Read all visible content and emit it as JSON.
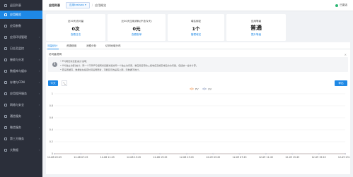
{
  "sidebar": {
    "brand": "返回列表",
    "items": [
      {
        "label": "应用概览",
        "active": true
      },
      {
        "label": "应用参数"
      },
      {
        "label": "应用环境管理",
        "arrow": true
      },
      {
        "label": "日志及监控",
        "arrow": true
      },
      {
        "label": "接收与分发",
        "arrow": true
      },
      {
        "label": "数据库与缓存",
        "arrow": true
      },
      {
        "label": "存储与CDN",
        "arrow": true
      },
      {
        "label": "应用程序服务",
        "arrow": true
      },
      {
        "label": "网络与安全",
        "arrow": true
      },
      {
        "label": "通信服务",
        "arrow": true
      },
      {
        "label": "微信服务",
        "arrow": true
      },
      {
        "label": "第三方服务",
        "arrow": true
      },
      {
        "label": "大数据",
        "arrow": true
      }
    ]
  },
  "header": {
    "crumb_root": "应用列表",
    "app_select": "应用testsws",
    "crumb_current": "应用概览",
    "status": "已激活"
  },
  "cards": [
    {
      "title": "近30天访问量",
      "value": "0次",
      "link": "查看日志"
    },
    {
      "title": "近30天应用消耗(不含今天)",
      "value": "0元",
      "link": "查看账单"
    },
    {
      "title": "域名绑定",
      "value": "1个",
      "link": "管理域名"
    },
    {
      "title": "应用等级",
      "value": "普通",
      "link": "提升等级"
    }
  ],
  "tabs": [
    {
      "label": "流量统计",
      "active": true
    },
    {
      "label": "资源使用"
    },
    {
      "label": "消费分析"
    },
    {
      "label": "访问地域分布"
    }
  ],
  "notice": {
    "title": "访问量说明",
    "close": "×",
    "lines": [
      "• PV(网页浏览量)统计说明：",
      "• UV(独立访客)统计：同一个不同IP与相同浏览器浏览的同一个独立访问客，重应用自带的二级域名及绑定域名的访问量，包括统一合并计算。",
      "• 若设置缓存，数据会在指定时间后再更新，可能显示的是有上限，无数据不统计。"
    ]
  },
  "toolbar": {
    "today_button": "今天",
    "expand_icon_glyph": "⤡",
    "export_button": "导出"
  },
  "chart_data": {
    "type": "line",
    "legend": [
      "PV",
      "UV"
    ],
    "legend_position": "top-center",
    "x": [
      "12-08 03:45",
      "12-08 07:45",
      "12-08 11:45",
      "12-08 15:45",
      "12-08 19:45",
      "12-08 23:45",
      "12-09 03:45",
      "12-09 07:45",
      "12-09 11:45",
      "12-09 15:45",
      "12-09 19:45",
      "12-09 23:45"
    ],
    "series": [
      {
        "name": "PV",
        "values": [
          0,
          0,
          0,
          0,
          0,
          0,
          0,
          0,
          0,
          0,
          0,
          0
        ],
        "color": "#f4a56a"
      },
      {
        "name": "UV",
        "values": [
          0,
          0,
          0,
          0,
          0,
          0,
          0,
          0,
          0,
          0,
          0,
          0
        ],
        "color": "#9aa9c9"
      }
    ],
    "y_ticks": [
      "0",
      "0.2",
      "0.4",
      "0.6",
      "0.8",
      "1"
    ],
    "ylim": [
      0,
      1
    ],
    "grid": true
  },
  "colors": {
    "accent": "#1e88e5",
    "sidebar_bg": "#2b2f3a",
    "success": "#2bb673"
  }
}
